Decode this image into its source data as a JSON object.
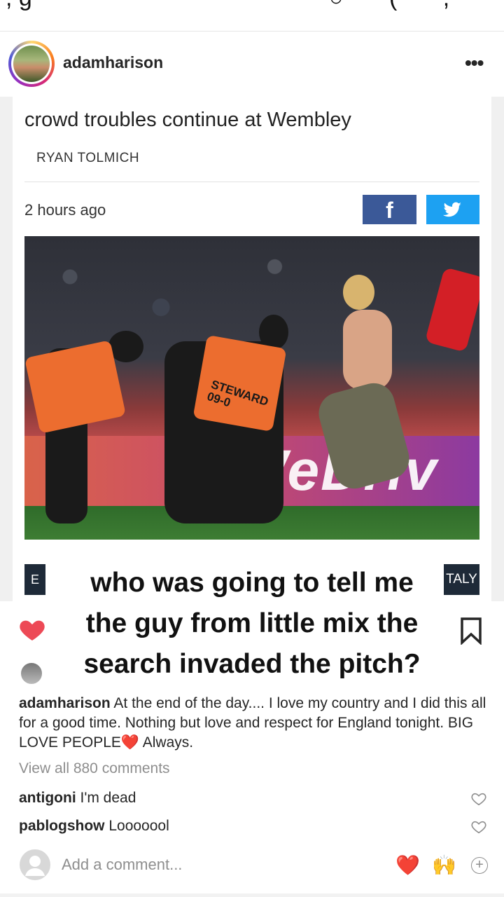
{
  "post": {
    "username": "adamharison",
    "more_label": "•••"
  },
  "article": {
    "headline": "crowd troubles continue at Wembley",
    "author": "RYAN TOLMICH",
    "time": "2 hours ago",
    "facebook_label": "f",
    "board_text": "#WeDriv",
    "vest_text": "STEWARD\n09-0",
    "left_box": "E",
    "right_box": "TALY"
  },
  "overlay": {
    "line1": "who was going to tell me",
    "line2": "the guy from little mix the",
    "line3": "search invaded the pitch?"
  },
  "caption": {
    "username": "adamharison",
    "text": "At the end of the day.... I love my country and I did this all for a good time. Nothing but love and respect for England tonight. BIG LOVE PEOPLE",
    "text_end": "Always.",
    "heart_emoji": "❤️"
  },
  "view_all": "View all 880 comments",
  "comments": [
    {
      "user": "antigoni",
      "text": "I'm dead"
    },
    {
      "user": "pablogshow",
      "text": "Looooool"
    }
  ],
  "add_comment": {
    "placeholder": "Add a comment...",
    "emoji1": "❤️",
    "emoji2": "🙌",
    "plus": "+"
  },
  "icons": {
    "like": "heart-icon",
    "save": "bookmark-icon",
    "more": "more-icon",
    "facebook": "facebook-icon",
    "twitter": "twitter-icon"
  },
  "colors": {
    "like_red": "#ed4956",
    "facebook_blue": "#3b5998",
    "twitter_blue": "#1da1f2"
  }
}
